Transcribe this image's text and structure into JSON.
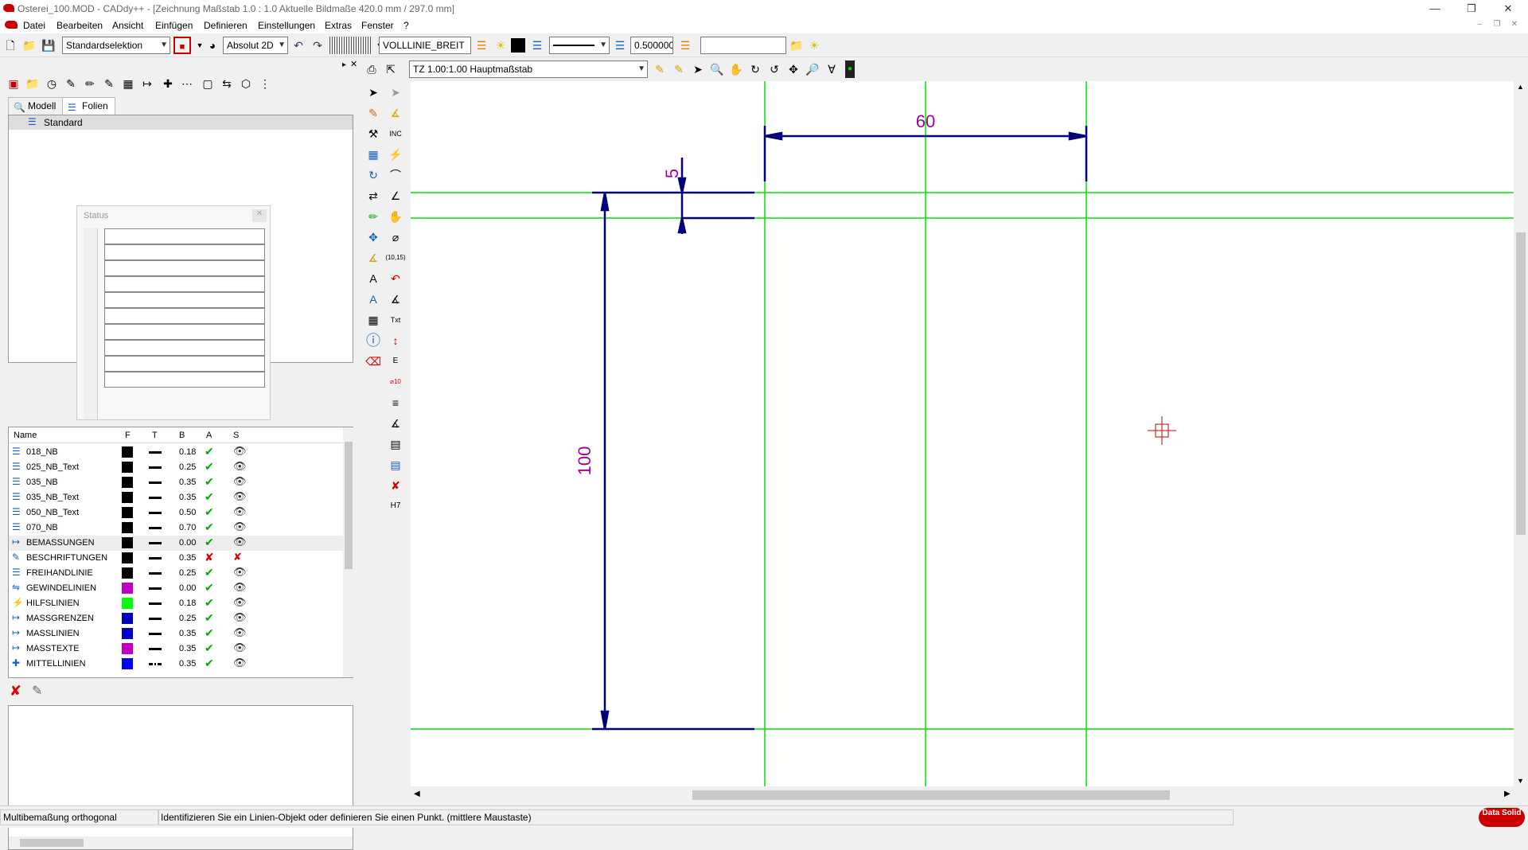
{
  "titlebar": {
    "title": "Osterei_100.MOD  -  CADdy++ - [Zeichnung   Maßstab 1.0 : 1.0   Aktuelle Bildmaße 420.0 mm / 297.0 mm]"
  },
  "menu": [
    "Datei",
    "Bearbeiten",
    "Ansicht",
    "Einfügen",
    "Definieren",
    "Einstellungen",
    "Extras",
    "Fenster",
    "?"
  ],
  "toolbar": {
    "selection": "Standardselektion",
    "coord_mode": "Absolut 2D",
    "line_type": "VOLLLINIE_BREIT",
    "line_width": "0.500000",
    "search": ""
  },
  "view": {
    "scale": "TZ 1.00:1.00 Hauptmaßstab"
  },
  "tabs": [
    "Modell",
    "Folien"
  ],
  "tree": {
    "root": "Standard"
  },
  "status_window": {
    "title": "Status"
  },
  "layers": {
    "headers": [
      "Name",
      "F",
      "T",
      "B",
      "A",
      "S"
    ],
    "rows": [
      {
        "name": "018_NB",
        "color": "#000000",
        "b": "0.18",
        "a": true,
        "s": true
      },
      {
        "name": "025_NB_Text",
        "color": "#000000",
        "b": "0.25",
        "a": true,
        "s": true
      },
      {
        "name": "035_NB",
        "color": "#000000",
        "b": "0.35",
        "a": true,
        "s": true
      },
      {
        "name": "035_NB_Text",
        "color": "#000000",
        "b": "0.35",
        "a": true,
        "s": true
      },
      {
        "name": "050_NB_Text",
        "color": "#000000",
        "b": "0.50",
        "a": true,
        "s": true
      },
      {
        "name": "070_NB",
        "color": "#000000",
        "b": "0.70",
        "a": true,
        "s": true
      },
      {
        "name": "BEMASSUNGEN",
        "color": "#000000",
        "b": "0.00",
        "a": true,
        "s": true
      },
      {
        "name": "BESCHRIFTUNGEN",
        "color": "#000000",
        "b": "0.35",
        "a": false,
        "s": false
      },
      {
        "name": "FREIHANDLINIE",
        "color": "#000000",
        "b": "0.25",
        "a": true,
        "s": true
      },
      {
        "name": "GEWINDELINIEN",
        "color": "#c000c0",
        "b": "0.00",
        "a": true,
        "s": true
      },
      {
        "name": "HILFSLINIEN",
        "color": "#00ff00",
        "b": "0.18",
        "a": true,
        "s": true
      },
      {
        "name": "MASSGRENZEN",
        "color": "#0000c0",
        "b": "0.25",
        "a": true,
        "s": true
      },
      {
        "name": "MASSLINIEN",
        "color": "#0000c0",
        "b": "0.35",
        "a": true,
        "s": true
      },
      {
        "name": "MASSTEXTE",
        "color": "#c000c0",
        "b": "0.35",
        "a": true,
        "s": true
      },
      {
        "name": "MITTELLINIEN",
        "color": "#0000ff",
        "b": "0.35",
        "a": true,
        "s": true
      }
    ]
  },
  "drawing": {
    "dim_top": "60",
    "dim_small": "5",
    "dim_left": "100"
  },
  "statusbar": {
    "mode": "Multibemaßung orthogonal",
    "prompt": "Identifizieren Sie ein Linien-Objekt oder definieren Sie einen Punkt.  (mittlere Maustaste)"
  },
  "brand": {
    "logo": "Data Solid"
  },
  "colors": {
    "construction": "#00e000",
    "dimension": "#00007a",
    "dim_text": "#a000a0",
    "cursor": "#c00000"
  }
}
